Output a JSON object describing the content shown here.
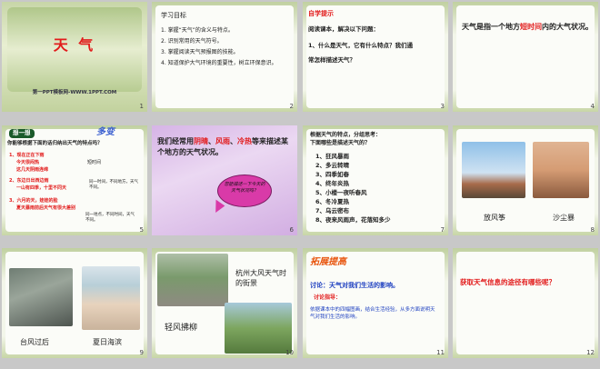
{
  "slides": [
    {
      "num": "1",
      "title": "天 气",
      "footer": "第一PPT模板网-WWW.1PPT.COM"
    },
    {
      "num": "2",
      "heading": "学习目标",
      "items": [
        "1. 掌握“天气”的含义与特点。",
        "2. 识别常用的天气符号。",
        "3. 掌握阅读天气预报图的技能。",
        "4. 知道保护大气环境的重要性，树立环保意识。"
      ]
    },
    {
      "num": "3",
      "label": "自学提示",
      "lines": [
        "阅读课本，解决以下问题：",
        "1、什么是天气，它有什么特点？我们通",
        "常怎样描述天气？"
      ]
    },
    {
      "num": "4",
      "pre": "天气是指一个地方",
      "hl": "短时间",
      "post": "内的大气状况。"
    },
    {
      "num": "5",
      "tag": "想一想",
      "deco": "多变",
      "q": "你能够根据下面的话归纳出天气的特点吗？",
      "l1": "1、现在正在下雨",
      "l2": "今天很闷热",
      "l3": "这几天阴雨连绵",
      "n1": "短时间",
      "l4": "2、东边日出西边雨",
      "l5": "一山有四季，十里不同天",
      "n2": "同一时间，不同地方，天气不同。",
      "l6": "3、六月的天，娃娃的脸",
      "l7": "夏天暴雨前后天气有很大差别",
      "n3": "同一地点，不同时间，天气不同。"
    },
    {
      "num": "6",
      "pre": "我们经常用",
      "w1": "阴晴",
      "sep1": "、",
      "w2": "风雨",
      "sep2": "、",
      "w3": "冷热",
      "post": "等来描述某个地方的天气状况。",
      "bubble": "您能描述一下今天的天气状况吗？"
    },
    {
      "num": "7",
      "head1": "根据天气的特点，分组思考：",
      "head2": "下面哪些是描述天气的？",
      "items": [
        "1、狂风暴雨",
        "2、多云转晴",
        "3、四季如春",
        "4、终年炎热",
        "5、小楼一夜听春风",
        "6、冬冷夏热",
        "7、乌云密布",
        "8、夜来风雨声，花落知多少"
      ]
    },
    {
      "num": "8",
      "cap1": "放风筝",
      "cap2": "沙尘暴"
    },
    {
      "num": "9",
      "cap1": "台风过后",
      "cap2": "夏日海滨"
    },
    {
      "num": "10",
      "cap1": "杭州大风天气时的街景",
      "cap2": "轻风拂柳"
    },
    {
      "num": "11",
      "tag": "拓展提高",
      "q": "讨论：天气对我们生活的影响。",
      "guide": "讨论指导：",
      "body": "依据课本中的四幅图画，结合生活经验，从多方面说明天气对我们生活的影响。"
    },
    {
      "num": "12",
      "q": "获取天气信息的途径有哪些呢？"
    }
  ],
  "colors": {
    "accent_red": "#e21b1b",
    "panel_green": "#c8d6a8",
    "bubble": "#d93aa8"
  }
}
